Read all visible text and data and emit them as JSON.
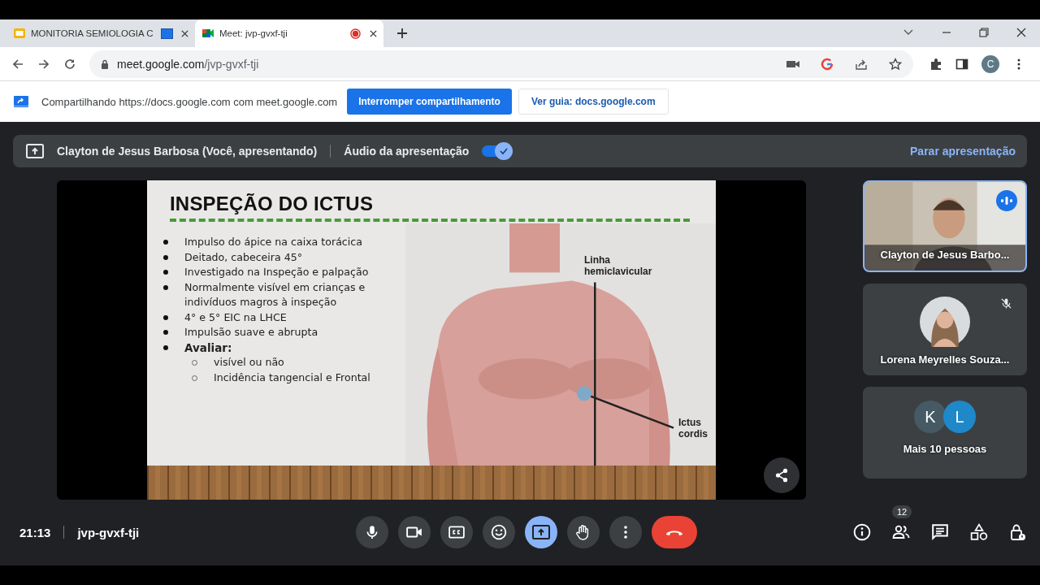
{
  "tabs": [
    {
      "title": "MONITORIA SEMIOLOGIA C",
      "selected": false,
      "kind": "slides"
    },
    {
      "title": "Meet: jvp-gvxf-tji",
      "selected": true,
      "kind": "meet"
    }
  ],
  "address": {
    "domain": "meet.google.com",
    "path": "/jvp-gvxf-tji"
  },
  "profile_letter": "C",
  "share_bar": {
    "message": "Compartilhando https://docs.google.com com meet.google.com",
    "stop_button": "Interromper compartilhamento",
    "guide_button": "Ver guia: docs.google.com"
  },
  "presenter_bar": {
    "name": "Clayton de Jesus Barbosa (Você, apresentando)",
    "audio_label": "Áudio da apresentação",
    "audio_on": true,
    "stop_label": "Parar apresentação"
  },
  "slide": {
    "title": "INSPEÇÃO DO ICTUS",
    "bullets": [
      {
        "text": "Impulso do ápice na caixa torácica",
        "bold": false
      },
      {
        "text": "Deitado, cabeceira 45°",
        "bold": false
      },
      {
        "text": "Investigado na Inspeção e palpação",
        "bold": false
      },
      {
        "text": "Normalmente visível em crianças e indivíduos magros à inspeção",
        "bold": false
      },
      {
        "text": "4° e 5° EIC na LHCE",
        "bold": false
      },
      {
        "text": "Impulsão suave e abrupta",
        "bold": false
      },
      {
        "text": "Avaliar:",
        "bold": true,
        "children": [
          {
            "text": "visível ou não",
            "bold": false
          },
          {
            "text": "Incidência tangencial e Frontal",
            "bold": false
          }
        ]
      }
    ],
    "figure_labels": [
      {
        "lines": [
          "Linha",
          "hemiclavicular"
        ]
      },
      {
        "lines": [
          "Ictus",
          "cordis"
        ]
      }
    ]
  },
  "participants": [
    {
      "name": "Clayton de Jesus Barbo...",
      "kind": "video",
      "speaking": true,
      "muted": false
    },
    {
      "name": "Lorena Meyrelles Souza...",
      "kind": "avatar",
      "speaking": false,
      "muted": true
    }
  ],
  "more": {
    "avatars": [
      {
        "letter": "K",
        "color": "#455a64"
      },
      {
        "letter": "L",
        "color": "#1e88c9"
      }
    ],
    "label": "Mais 10 pessoas"
  },
  "footer": {
    "time": "21:13",
    "meeting_code": "jvp-gvxf-tji",
    "presenting": true,
    "people_count": "12"
  }
}
